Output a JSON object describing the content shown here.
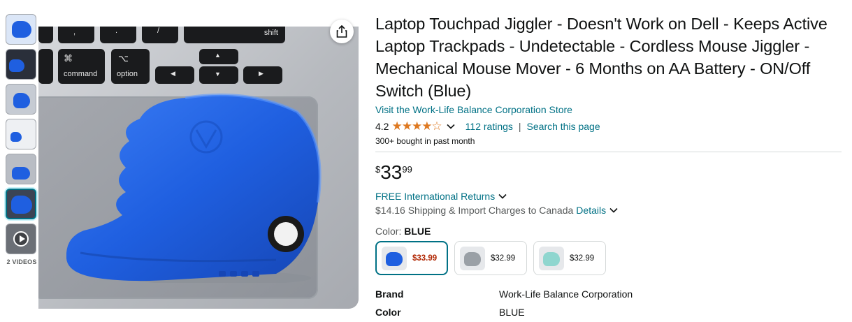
{
  "thumbnails": {
    "videos_label": "2 VIDEOS"
  },
  "main_image": {
    "keys": {
      "shift": "shift",
      "command_symbol": "⌘",
      "command": "command",
      "option_symbol": "⌥",
      "option": "option",
      "comma": ",",
      "period": ".",
      "slash": "/",
      "up": "▲",
      "left": "◀",
      "down": "▼",
      "right": "▶"
    }
  },
  "product": {
    "title": "Laptop Touchpad Jiggler - Doesn't Work on Dell - Keeps Active Laptop Trackpads - Undetectable - Cordless Mouse Jiggler - Mechanical Mouse Mover - 6 Months on AA Battery - ON/Off Switch (Blue)",
    "store_link": "Visit the Work-Life Balance Corporation Store",
    "rating": "4.2",
    "stars": "★★★★☆",
    "ratings_link": "112 ratings",
    "separator": "|",
    "search_link": "Search this page",
    "bought": "300+ bought in past month",
    "price_symbol": "$",
    "price_whole": "33",
    "price_fraction": "99",
    "returns": "FREE International Returns",
    "shipping": "$14.16 Shipping & Import Charges to Canada",
    "details_link": "Details",
    "color_label": "Color:",
    "color_value": "BLUE",
    "swatches": [
      {
        "price": "$33.99",
        "color": "#1f5fe0"
      },
      {
        "price": "$32.99",
        "color": "#9aa0a6"
      },
      {
        "price": "$32.99",
        "color": "#8fd6cf"
      }
    ],
    "specs": [
      {
        "key": "Brand",
        "value": "Work-Life Balance Corporation"
      },
      {
        "key": "Color",
        "value": "BLUE"
      }
    ]
  },
  "colors": {
    "accent_link": "#007185",
    "star": "#de7921",
    "device_blue": "#1f5fe0"
  }
}
